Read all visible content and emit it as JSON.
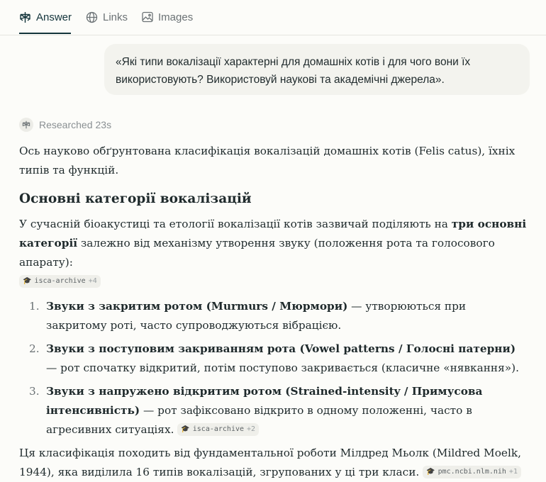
{
  "tabs": [
    {
      "label": "Answer",
      "icon": "perplexity-icon",
      "active": true
    },
    {
      "label": "Links",
      "icon": "globe-icon",
      "active": false
    },
    {
      "label": "Images",
      "icon": "image-icon",
      "active": false
    }
  ],
  "query": "«Які типи вокалізації характерні для домашніх котів і для чого вони їх використовують? Використовуй наукові та академічні джерела».",
  "researched": {
    "label": "Researched",
    "duration": "23s"
  },
  "intro": "Ось науково обґрунтована класифікація вокалізацій домашніх котів (Felis catus), їхніх типів та функцій.",
  "section_title": "Основні категорії вокалізацій",
  "p2": {
    "a": "У сучасній біоакустиці та етології вокалізації котів зазвичай поділяють на ",
    "b": "три основні категорії",
    "c": " залежно від механізму утворення звуку (положення рота та голосового апарату):",
    "cite_source": "isca-archive",
    "cite_more": "+4"
  },
  "list": [
    {
      "num": "1.",
      "bold": "Звуки з закритим ротом (Murmurs / Мюрмори)",
      "text": " — утворюються при закритому роті, часто супроводжуються вібрацією."
    },
    {
      "num": "2.",
      "bold": "Звуки з поступовим закриванням рота (Vowel patterns / Голосні патерни)",
      "text": " — рот спочатку відкритий, потім поступово закривається (класичне «нявкання»)."
    },
    {
      "num": "3.",
      "bold": "Звуки з напружено відкритим ротом (Strained-intensity / Примусова інтенсивність)",
      "text": " — рот зафіксовано відкрито в одному положенні, часто в агресивних ситуаціях. ",
      "cite_source": "isca-archive",
      "cite_more": "+2"
    }
  ],
  "closing": {
    "text": "Ця класифікація походить від фундаментальної роботи Мілдред Мьолк (Mildred Moelk, 1944), яка виділила 16 типів вокалізацій, згрупованих у ці три класи. ",
    "cite_source": "pmc.ncbi.nlm.nih",
    "cite_more": "+1"
  }
}
